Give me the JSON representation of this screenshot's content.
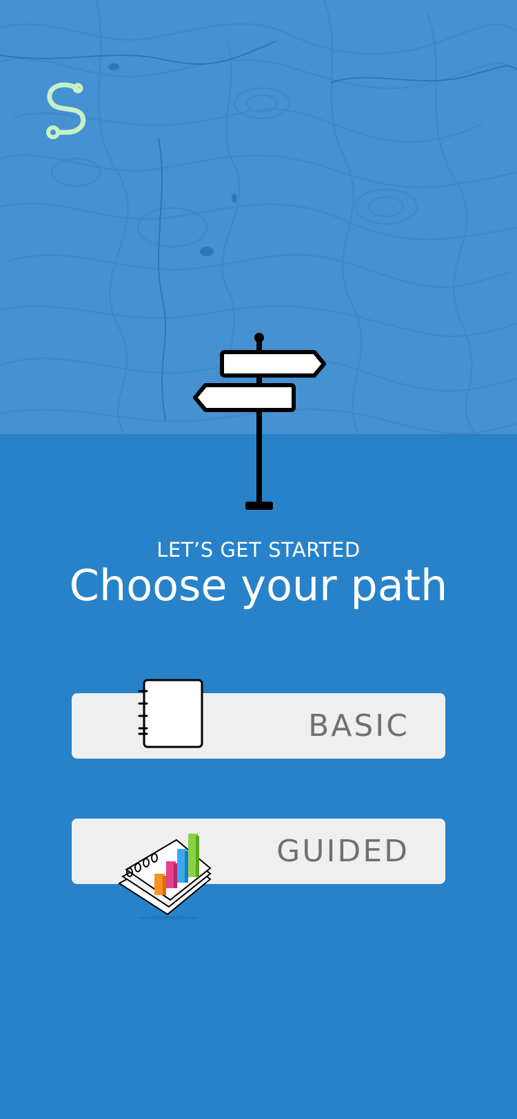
{
  "colors": {
    "background": "#2782c9",
    "hero_background": "#4591d1",
    "logo": "#c7f1c4",
    "button_background": "#efefef",
    "button_text": "#707070"
  },
  "icons": {
    "logo": "route-s-logo",
    "hero": "signpost-icon",
    "basic": "notebook-icon",
    "guided": "bar-chart-notebook-icon"
  },
  "heading": {
    "eyebrow": "LET’S GET STARTED",
    "title": "Choose your path"
  },
  "options": {
    "basic_label": "BASIC",
    "guided_label": "GUIDED"
  }
}
